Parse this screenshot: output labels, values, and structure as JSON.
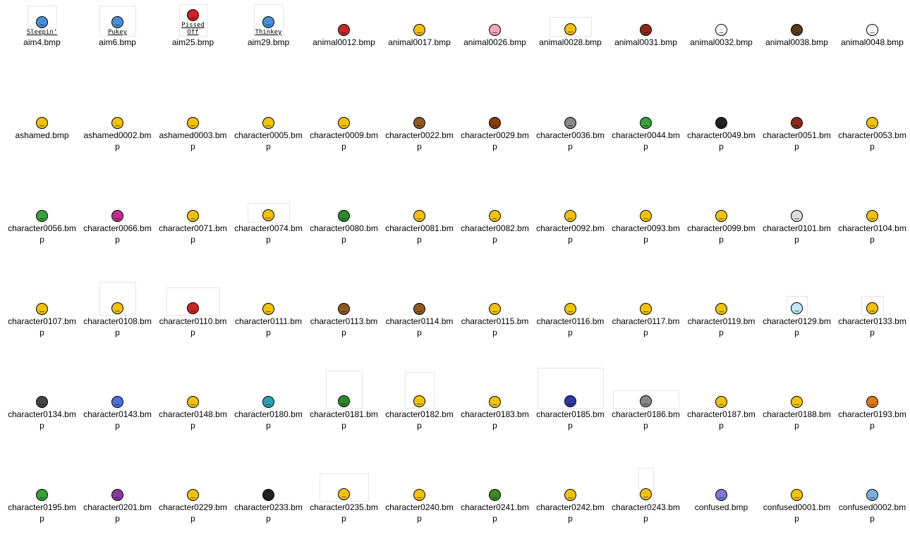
{
  "files": [
    {
      "name": "aim4.bmp",
      "icon": "sleepin-smiley-icon",
      "color": "#4a90d9",
      "w": 40,
      "h": 42,
      "caption": "Sleepin'",
      "frame": true
    },
    {
      "name": "aim6.bmp",
      "icon": "pukey-smiley-icon",
      "color": "#4a90d9",
      "w": 50,
      "h": 42,
      "caption": "Pukey",
      "frame": true
    },
    {
      "name": "aim25.bmp",
      "icon": "pissed-off-smiley-icon",
      "color": "#d32020",
      "w": 38,
      "h": 44,
      "caption": "Pissed Off",
      "frame": true
    },
    {
      "name": "aim29.bmp",
      "icon": "thinkey-smiley-icon",
      "color": "#4a90d9",
      "w": 40,
      "h": 44,
      "caption": "Thinkey",
      "frame": true
    },
    {
      "name": "animal0012.bmp",
      "icon": "spider-icon",
      "color": "#c62828",
      "w": 66,
      "h": 26,
      "frame": false
    },
    {
      "name": "animal0017.bmp",
      "icon": "spider-smiley-icon",
      "color": "#f2c200",
      "w": 48,
      "h": 26,
      "frame": false
    },
    {
      "name": "animal0026.bmp",
      "icon": "pig-icon",
      "color": "#f4a8b8",
      "w": 26,
      "h": 24,
      "frame": false
    },
    {
      "name": "animal0028.bmp",
      "icon": "fish-icon",
      "color": "#f2c200",
      "w": 58,
      "h": 26,
      "frame": true
    },
    {
      "name": "animal0031.bmp",
      "icon": "chicken-icon",
      "color": "#8b2a1a",
      "w": 24,
      "h": 34,
      "frame": false
    },
    {
      "name": "animal0032.bmp",
      "icon": "cat-icon",
      "color": "#ffffff",
      "w": 22,
      "h": 22,
      "frame": false
    },
    {
      "name": "animal0038.bmp",
      "icon": "bear-icon",
      "color": "#5a3a1a",
      "w": 22,
      "h": 22,
      "frame": false
    },
    {
      "name": "animal0048.bmp",
      "icon": "rabbit-icon",
      "color": "#ffffff",
      "w": 26,
      "h": 30,
      "frame": false
    },
    {
      "name": "ashamed.bmp",
      "icon": "ashamed-smiley-icon",
      "color": "#f2c200",
      "w": 18,
      "h": 18,
      "frame": false
    },
    {
      "name": "ashamed0002.bmp",
      "icon": "ashamed-smiley-icon",
      "color": "#f2c200",
      "w": 20,
      "h": 20,
      "frame": false
    },
    {
      "name": "ashamed0003.bmp",
      "icon": "ashamed-smiley-icon",
      "color": "#f2c200",
      "w": 20,
      "h": 20,
      "frame": false
    },
    {
      "name": "character0005.bmp",
      "icon": "character-smiley-icon",
      "color": "#f2c200",
      "w": 26,
      "h": 28,
      "frame": false
    },
    {
      "name": "character0009.bmp",
      "icon": "character-smiley-icon",
      "color": "#f2c200",
      "w": 24,
      "h": 24,
      "frame": false
    },
    {
      "name": "character0022.bmp",
      "icon": "character-smiley-icon",
      "color": "#8b5a20",
      "w": 28,
      "h": 26,
      "frame": false
    },
    {
      "name": "character0029.bmp",
      "icon": "character-smiley-icon",
      "color": "#8b3a10",
      "w": 32,
      "h": 30,
      "frame": false
    },
    {
      "name": "character0036.bmp",
      "icon": "chainsaw-smiley-icon",
      "color": "#888888",
      "w": 58,
      "h": 22,
      "frame": false
    },
    {
      "name": "character0044.bmp",
      "icon": "character-smiley-icon",
      "color": "#3aa13a",
      "w": 22,
      "h": 22,
      "frame": false
    },
    {
      "name": "character0049.bmp",
      "icon": "ninja-smiley-icon",
      "color": "#222222",
      "w": 22,
      "h": 22,
      "frame": false
    },
    {
      "name": "character0051.bmp",
      "icon": "violin-smiley-icon",
      "color": "#8b2a1a",
      "w": 42,
      "h": 38,
      "frame": false
    },
    {
      "name": "character0053.bmp",
      "icon": "fishing-smiley-icon",
      "color": "#f2c200",
      "w": 62,
      "h": 24,
      "frame": false
    },
    {
      "name": "character0056.bmp",
      "icon": "character-smiley-icon",
      "color": "#3aa13a",
      "w": 40,
      "h": 30,
      "frame": false
    },
    {
      "name": "character0066.bmp",
      "icon": "flower-smiley-icon",
      "color": "#c0308a",
      "w": 40,
      "h": 28,
      "frame": false
    },
    {
      "name": "character0071.bmp",
      "icon": "binoculars-smiley-icon",
      "color": "#f2c200",
      "w": 38,
      "h": 22,
      "frame": false
    },
    {
      "name": "character0074.bmp",
      "icon": "character-smiley-icon",
      "color": "#f2c200",
      "w": 58,
      "h": 26,
      "frame": true
    },
    {
      "name": "character0080.bmp",
      "icon": "character-smiley-icon",
      "color": "#2a8a2a",
      "w": 26,
      "h": 34,
      "frame": false
    },
    {
      "name": "character0081.bmp",
      "icon": "character-smiley-icon",
      "color": "#f2c200",
      "w": 20,
      "h": 20,
      "frame": false
    },
    {
      "name": "character0082.bmp",
      "icon": "character-smiley-icon",
      "color": "#f2c200",
      "w": 24,
      "h": 24,
      "frame": false
    },
    {
      "name": "character0092.bmp",
      "icon": "character-smiley-icon",
      "color": "#f2c200",
      "w": 44,
      "h": 28,
      "frame": false
    },
    {
      "name": "character0093.bmp",
      "icon": "band-smiley-icon",
      "color": "#f2c200",
      "w": 92,
      "h": 28,
      "frame": false
    },
    {
      "name": "character0099.bmp",
      "icon": "character-smiley-icon",
      "color": "#f2c200",
      "w": 22,
      "h": 24,
      "frame": false
    },
    {
      "name": "character0101.bmp",
      "icon": "lightbulb-smiley-icon",
      "color": "#dddddd",
      "w": 22,
      "h": 28,
      "frame": false
    },
    {
      "name": "character0104.bmp",
      "icon": "fork-knife-smiley-icon",
      "color": "#f2c200",
      "w": 34,
      "h": 28,
      "frame": false
    },
    {
      "name": "character0107.bmp",
      "icon": "character-smiley-icon",
      "color": "#f2c200",
      "w": 22,
      "h": 22,
      "frame": false
    },
    {
      "name": "character0108.bmp",
      "icon": "character-smiley-icon",
      "color": "#f2c200",
      "w": 50,
      "h": 46,
      "frame": true
    },
    {
      "name": "character0110.bmp",
      "icon": "guitar-smiley-icon",
      "color": "#c62828",
      "w": 74,
      "h": 38,
      "frame": true
    },
    {
      "name": "character0111.bmp",
      "icon": "character-smiley-icon",
      "color": "#f2c200",
      "w": 32,
      "h": 56,
      "frame": false
    },
    {
      "name": "character0113.bmp",
      "icon": "computer-smiley-icon",
      "color": "#8b5a20",
      "w": 52,
      "h": 22,
      "frame": false
    },
    {
      "name": "character0114.bmp",
      "icon": "computer-smiley-icon",
      "color": "#8b5a20",
      "w": 52,
      "h": 22,
      "frame": false
    },
    {
      "name": "character0115.bmp",
      "icon": "character-smiley-icon",
      "color": "#f2c200",
      "w": 34,
      "h": 20,
      "frame": false
    },
    {
      "name": "character0116.bmp",
      "icon": "weightlifting-smiley-icon",
      "color": "#f2c200",
      "w": 38,
      "h": 22,
      "frame": false
    },
    {
      "name": "character0117.bmp",
      "icon": "sailboat-smiley-icon",
      "color": "#f2c200",
      "w": 30,
      "h": 34,
      "frame": false
    },
    {
      "name": "character0119.bmp",
      "icon": "basketball-smiley-icon",
      "color": "#f2c200",
      "w": 32,
      "h": 22,
      "frame": false
    },
    {
      "name": "character0129.bmp",
      "icon": "character-smiley-icon",
      "color": "#bfe8ff",
      "w": 28,
      "h": 26,
      "frame": true
    },
    {
      "name": "character0133.bmp",
      "icon": "character-smiley-icon",
      "color": "#f2c200",
      "w": 30,
      "h": 26,
      "frame": true
    },
    {
      "name": "character0134.bmp",
      "icon": "vampire-smiley-icon",
      "color": "#444444",
      "w": 22,
      "h": 22,
      "frame": false
    },
    {
      "name": "character0143.bmp",
      "icon": "flower-smiley-icon",
      "color": "#4a70d9",
      "w": 26,
      "h": 22,
      "frame": false
    },
    {
      "name": "character0148.bmp",
      "icon": "character-smiley-icon",
      "color": "#f2c200",
      "w": 40,
      "h": 18,
      "frame": false
    },
    {
      "name": "character0180.bmp",
      "icon": "surfing-smiley-icon",
      "color": "#2aa0b0",
      "w": 50,
      "h": 28,
      "frame": false
    },
    {
      "name": "character0181.bmp",
      "icon": "christmas-tree-smiley-icon",
      "color": "#2a8a2a",
      "w": 50,
      "h": 52,
      "frame": true
    },
    {
      "name": "character0182.bmp",
      "icon": "steering-wheel-smiley-icon",
      "color": "#f2c200",
      "w": 40,
      "h": 50,
      "frame": true
    },
    {
      "name": "character0183.bmp",
      "icon": "character-smiley-icon",
      "color": "#f2c200",
      "w": 34,
      "h": 20,
      "frame": false
    },
    {
      "name": "character0185.bmp",
      "icon": "wizard-smiley-icon",
      "color": "#2a3aa0",
      "w": 92,
      "h": 56,
      "frame": true
    },
    {
      "name": "character0186.bmp",
      "icon": "wall-smiley-icon",
      "color": "#888888",
      "w": 92,
      "h": 24,
      "frame": true
    },
    {
      "name": "character0187.bmp",
      "icon": "character-smiley-icon",
      "color": "#f2c200",
      "w": 30,
      "h": 22,
      "frame": false
    },
    {
      "name": "character0188.bmp",
      "icon": "alien-smiley-icon",
      "color": "#f2c200",
      "w": 20,
      "h": 28,
      "frame": false
    },
    {
      "name": "character0193.bmp",
      "icon": "pumpkin-smiley-icon",
      "color": "#e07a10",
      "w": 22,
      "h": 20,
      "frame": false
    },
    {
      "name": "character0195.bmp",
      "icon": "helicopter-smiley-icon",
      "color": "#3aa13a",
      "w": 22,
      "h": 24,
      "frame": false
    },
    {
      "name": "character0201.bmp",
      "icon": "scooter-smiley-icon",
      "color": "#8a3aa0",
      "w": 40,
      "h": 28,
      "frame": false
    },
    {
      "name": "character0229.bmp",
      "icon": "police-smiley-icon",
      "color": "#f2c200",
      "w": 24,
      "h": 30,
      "frame": false
    },
    {
      "name": "character0233.bmp",
      "icon": "ninja-smiley-icon",
      "color": "#222222",
      "w": 22,
      "h": 22,
      "frame": false
    },
    {
      "name": "character0235.bmp",
      "icon": "banner-smiley-icon",
      "color": "#f2c200",
      "w": 68,
      "h": 38,
      "frame": true
    },
    {
      "name": "character0240.bmp",
      "icon": "character-smiley-icon",
      "color": "#f2c200",
      "w": 24,
      "h": 22,
      "frame": false
    },
    {
      "name": "character0241.bmp",
      "icon": "zombie-smiley-icon",
      "color": "#3a8a2a",
      "w": 24,
      "h": 22,
      "frame": false
    },
    {
      "name": "character0242.bmp",
      "icon": "character-smiley-icon",
      "color": "#f2c200",
      "w": 34,
      "h": 32,
      "frame": false
    },
    {
      "name": "character0243.bmp",
      "icon": "juggling-smiley-icon",
      "color": "#f2c200",
      "w": 20,
      "h": 46,
      "frame": true
    },
    {
      "name": "confused.bmp",
      "icon": "confused-smiley-icon",
      "color": "#7a7ad9",
      "w": 18,
      "h": 18,
      "frame": false
    },
    {
      "name": "confused0001.bmp",
      "icon": "glasses-smiley-icon",
      "color": "#f2c200",
      "w": 26,
      "h": 22,
      "frame": false
    },
    {
      "name": "confused0002.bmp",
      "icon": "confused-smiley-icon",
      "color": "#7ab0e0",
      "w": 20,
      "h": 20,
      "frame": false
    }
  ]
}
